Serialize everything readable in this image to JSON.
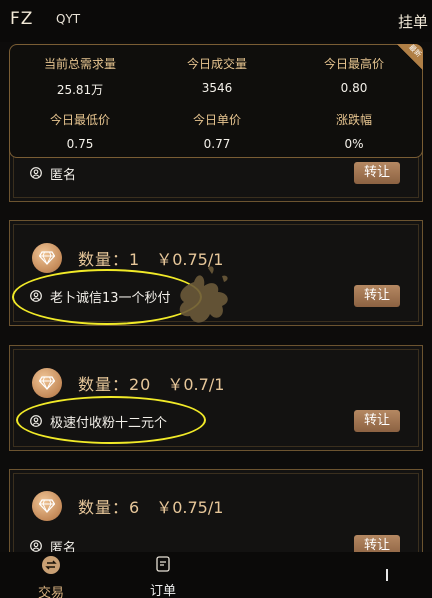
{
  "header": {
    "brand": "FZ",
    "coin": "QYT",
    "action": "挂单"
  },
  "stats": {
    "corner_label": "最新",
    "items": [
      {
        "label": "当前总需求量",
        "value": "25.81万"
      },
      {
        "label": "今日成交量",
        "value": "3546"
      },
      {
        "label": "今日最高价",
        "value": "0.80"
      },
      {
        "label": "今日最低价",
        "value": "0.75"
      },
      {
        "label": "今日单价",
        "value": "0.77"
      },
      {
        "label": "涨跌幅",
        "value": "0%"
      }
    ]
  },
  "listings": [
    {
      "quantity": "",
      "price": "",
      "user": "匿名",
      "button": "转让"
    },
    {
      "quantity": "数量：1",
      "price": "￥0.75/1",
      "user": "老卜诚信13一个秒付",
      "button": "转让"
    },
    {
      "quantity": "数量：20",
      "price": "￥0.7/1",
      "user": "极速付收粉十二元个",
      "button": "转让"
    },
    {
      "quantity": "数量：6",
      "price": "￥0.75/1",
      "user": "匿名",
      "button": "转让"
    }
  ],
  "tabbar": {
    "tabs": [
      {
        "label": "交易",
        "icon": "exchange-icon",
        "active": true
      },
      {
        "label": "订单",
        "icon": "order-doc-icon",
        "active": false
      }
    ]
  },
  "colors": {
    "accent": "#e7c79a",
    "border": "#6c5430",
    "background": "#0d0c0b",
    "highlight_ellipse": "#f1ea28"
  }
}
